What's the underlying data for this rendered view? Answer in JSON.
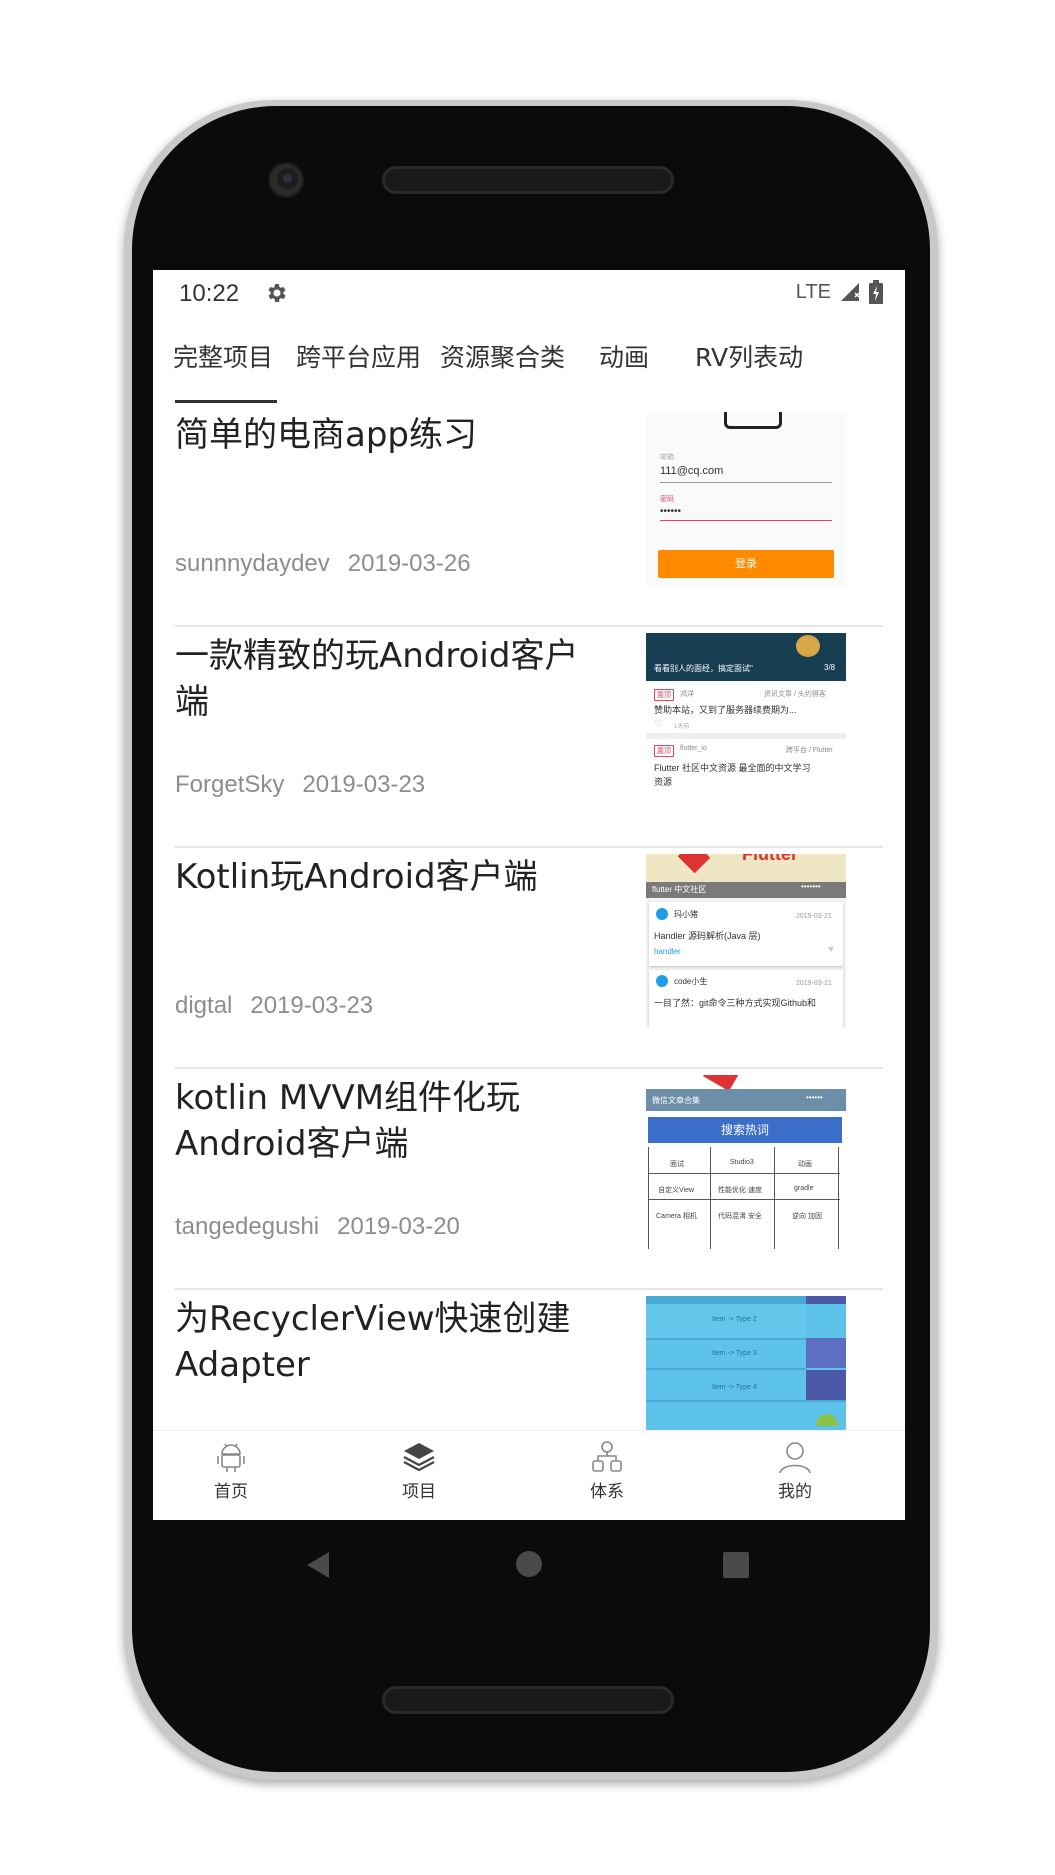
{
  "status_bar": {
    "time": "10:22",
    "network": "LTE"
  },
  "tabs": [
    {
      "label": "完整项目",
      "selected": true
    },
    {
      "label": "跨平台应用",
      "selected": false
    },
    {
      "label": "资源聚合类",
      "selected": false
    },
    {
      "label": "动画",
      "selected": false
    },
    {
      "label": "RV列表动",
      "selected": false
    }
  ],
  "items": [
    {
      "title": "简单的电商app练习",
      "author": "sunnnydaydev",
      "date": "2019-03-26",
      "thumb": {
        "label_email": "邮箱",
        "email": "111@cq.com",
        "label_password": "密码",
        "password": "••••••",
        "button": "登录",
        "button_color": "#ff8a00"
      }
    },
    {
      "title": "一款精致的玩Android客户端",
      "author": "ForgetSky",
      "date": "2019-03-23",
      "thumb": {
        "banner": "看看别人的面经，搞定面试\"",
        "page": "3/8",
        "tag1": "置顶",
        "source1": "鸿洋",
        "category1": "资讯文章 / 头约得客",
        "line1": "赞助本站，又到了服务器续费期为...",
        "likes": "1天前",
        "tag2": "置顶",
        "source2": "flutter_io",
        "category2": "跨平台 / Flutter",
        "line2": "Flutter 社区中文资源 最全面的中文学习",
        "line2b": "资源"
      }
    },
    {
      "title": "Kotlin玩Android客户端",
      "author": "digtal",
      "date": "2019-03-23",
      "thumb": {
        "header_big": "Flutter",
        "header": "flutter 中文社区",
        "card1_user": "玛小猪",
        "card1_date": "2019-03-21",
        "card1_title": "Handler 源码解析(Java 层)",
        "card1_tag": "handler",
        "card2_user": "code小生",
        "card2_date": "2019-03-21",
        "card2_title": "一目了然：git命令三种方式实现Github和"
      }
    },
    {
      "title": "kotlin MVVM组件化玩Android客户端",
      "author": "tangedegushi",
      "date": "2019-03-20",
      "thumb": {
        "header": "微信文章合集",
        "button": "搜索热词",
        "grid": [
          [
            "面试",
            "Studio3",
            "动画"
          ],
          [
            "自定义View",
            "性能优化 速度",
            "gradle"
          ],
          [
            "Camera 相机",
            "代码混淆 安全",
            "逆向 加固"
          ]
        ]
      }
    },
    {
      "title": "为RecyclerView快速创建Adapter",
      "author": "",
      "date": "",
      "thumb": {
        "rows": [
          "Item -> Type 2",
          "Item -> Type 3",
          "Item -> Type 4"
        ]
      }
    }
  ],
  "bottom_nav": [
    {
      "label": "首页",
      "icon": "android-icon"
    },
    {
      "label": "项目",
      "icon": "layers-icon"
    },
    {
      "label": "体系",
      "icon": "hierarchy-icon"
    },
    {
      "label": "我的",
      "icon": "person-icon"
    }
  ],
  "colors": {
    "text": "#222222",
    "meta": "#8d8d8d",
    "divider": "#e6e6e6",
    "accent_orange": "#ff8a00",
    "accent_blue": "#3a6ec8",
    "screen_bg": "#ffffff",
    "phone_bg": "#0b0b0b"
  }
}
